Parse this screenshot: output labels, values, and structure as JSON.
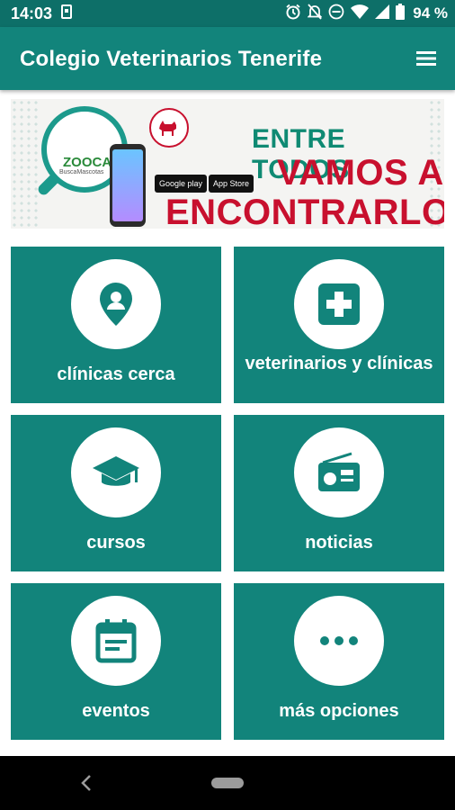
{
  "status_bar": {
    "time": "14:03",
    "battery_percent": "94 %",
    "icons": [
      "notification-icon",
      "alarm-icon",
      "mute-icon",
      "dnd-icon",
      "wifi-icon",
      "signal-icon",
      "battery-icon"
    ]
  },
  "app_bar": {
    "title": "Colegio Veterinarios Tenerife",
    "menu_icon": "hamburger-menu-icon"
  },
  "banner": {
    "logo_text": "ZOOCAN",
    "logo_subtext": "BuscaMascotas",
    "store_badges": [
      "Google play",
      "App Store"
    ],
    "headline_1": "ENTRE TODOS",
    "headline_2": "VAMOS A",
    "headline_3": "ENCONTRARLO"
  },
  "tiles": [
    {
      "label": "clínicas cerca",
      "icon": "location-pin-icon"
    },
    {
      "label": "veterinarios y clínicas",
      "icon": "medical-cross-icon"
    },
    {
      "label": "cursos",
      "icon": "graduation-cap-icon"
    },
    {
      "label": "noticias",
      "icon": "radio-icon"
    },
    {
      "label": "eventos",
      "icon": "calendar-icon"
    },
    {
      "label": "más opciones",
      "icon": "more-dots-icon"
    }
  ],
  "colors": {
    "primary": "#12847b",
    "primary_dark": "#0d6f68",
    "accent_red": "#c8102e",
    "accent_green": "#0f8a73"
  }
}
